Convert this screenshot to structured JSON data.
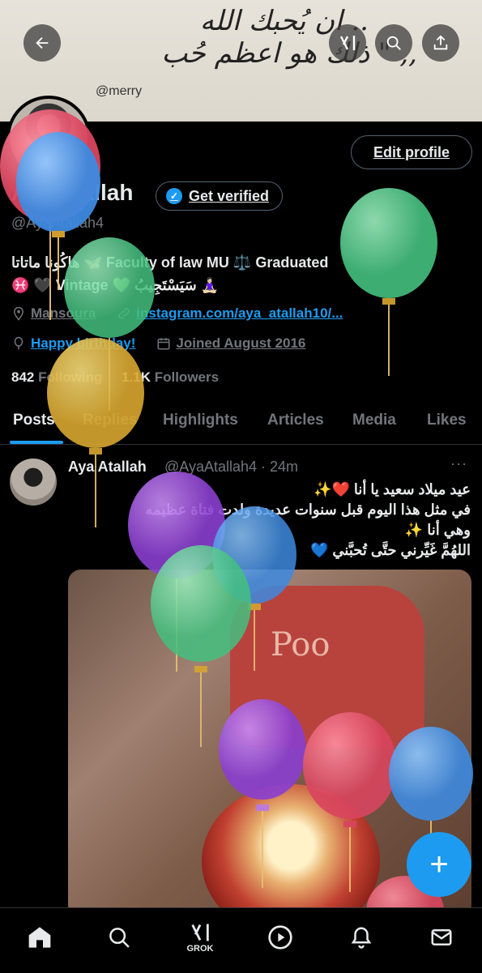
{
  "banner": {
    "script_line1": "ان يُحبك الله ..",
    "script_line2": "ذلك هو اعظم حُب \" ,,",
    "handle": "@merry"
  },
  "header": {
    "back_icon": "arrow-left-icon",
    "grok_icon": "grok-icon",
    "search_icon": "search-icon",
    "share_icon": "share-icon"
  },
  "profile": {
    "edit_label": "Edit profile",
    "name": "Aya Atallah",
    "get_verified_label": "Get verified",
    "handle": "@AyaAtallah4",
    "bio_line1": "هاكُونا ماتاتا 🦋 Faculty of law MU ⚖️ Graduated",
    "bio_line2": "♓ 🖤 Vintage 💚 سَيَسْتَجِيبُ 🧘🏻‍♀️",
    "location": "Mansoura",
    "website": "instagram.com/aya_atallah10/...",
    "birthday": "Happy birthday!",
    "joined": "Joined August 2016",
    "following_count": "842",
    "following_label": "Following",
    "followers_count": "1.1K",
    "followers_label": "Followers"
  },
  "tabs": [
    "Posts",
    "Replies",
    "Highlights",
    "Articles",
    "Media",
    "Likes"
  ],
  "post": {
    "name": "Aya Atallah",
    "meta": "@AyaAtallah4 · 24m",
    "more": "···",
    "text_line1": "عيد ميلاد سعيد يا أنا ❤️✨",
    "text_line2": "في مثل هذا اليوم قبل سنوات عديدة ولدت فتاة عظيمه",
    "text_line3": "وهي أنا ✨",
    "text_line4": "اللهُمَّ غَيِّرني حتَّى تُحبَّني 💙",
    "media_text": "Poo"
  },
  "fab_label": "+",
  "bottom_nav": {
    "home_icon": "home-icon",
    "search_icon": "search-icon",
    "grok_label": "GROK",
    "video_icon": "play-icon",
    "bell_icon": "bell-icon",
    "mail_icon": "mail-icon"
  },
  "colors": {
    "accent": "#1d9bf0",
    "background": "#000000",
    "muted": "#71767b"
  }
}
